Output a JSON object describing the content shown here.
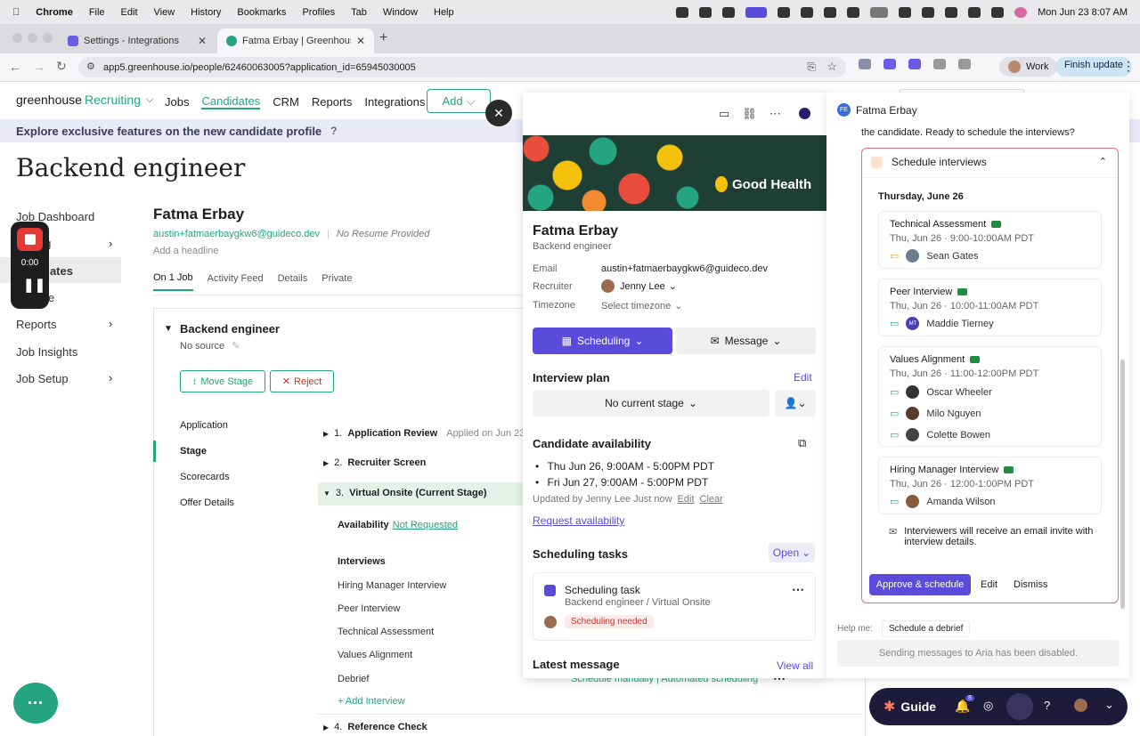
{
  "mac_menu": {
    "app": "Chrome",
    "items": [
      "File",
      "Edit",
      "View",
      "History",
      "Bookmarks",
      "Profiles",
      "Tab",
      "Window",
      "Help"
    ],
    "datetime": "Mon Jun 23  8:07 AM"
  },
  "tabs": [
    {
      "label": "Settings - Integrations"
    },
    {
      "label": "Fatma Erbay | Greenhouse Re"
    }
  ],
  "address": {
    "url": "app5.greenhouse.io/people/62460063005?application_id=65945030005",
    "profile": "Work",
    "finish": "Finish update"
  },
  "app_nav": {
    "brand": "greenhouse",
    "brand_sub": "Recruiting",
    "items": [
      "Jobs",
      "Candidates",
      "CRM",
      "Reports",
      "Integrations"
    ],
    "add": "Add"
  },
  "banner": {
    "text": "Explore exclusive features on the new candidate profile",
    "help": "?"
  },
  "page": {
    "title": "Backend engineer"
  },
  "sidebar": {
    "items": [
      "Job Dashboard",
      "ing",
      "dates",
      "e",
      "Reports",
      "Job Insights",
      "Job Setup"
    ]
  },
  "recorder": {
    "time": "0:00"
  },
  "candidate": {
    "name": "Fatma Erbay",
    "email": "austin+fatmaerbaygkw6@guideco.dev",
    "resume": "No Resume Provided",
    "headline": "Add a headline",
    "tabs": [
      "On 1 Job",
      "Activity Feed",
      "Details",
      "Private"
    ]
  },
  "job_card": {
    "title": "Backend engineer",
    "source": "No source",
    "move": "Move Stage",
    "reject": "Reject",
    "left_nav": [
      "Application",
      "Stage",
      "Scorecards",
      "Offer Details"
    ],
    "stages": [
      {
        "num": "1.",
        "label": "Application Review",
        "note": "Applied on Jun 23,"
      },
      {
        "num": "2.",
        "label": "Recruiter Screen",
        "note": ""
      },
      {
        "num": "3.",
        "label": "Virtual Onsite (Current Stage)",
        "note": ""
      }
    ],
    "availability_label": "Availability",
    "availability_value": "Not Requested",
    "interviews_label": "Interviews",
    "interviews": [
      "Hiring Manager Interview",
      "Peer Interview",
      "Technical Assessment",
      "Values Alignment",
      "Debrief"
    ],
    "add_interview": "+ Add Interview",
    "debrief_links": "Schedule manually | Automated scheduling",
    "stage4": {
      "num": "4.",
      "label": "Reference Check"
    }
  },
  "profile": {
    "banner_brand": "Good Health",
    "name": "Fatma Erbay",
    "role": "Backend engineer",
    "fields": [
      {
        "label": "Email",
        "value": "austin+fatmaerbaygkw6@guideco.dev"
      },
      {
        "label": "Recruiter",
        "value": "Jenny Lee"
      },
      {
        "label": "Timezone",
        "value": "Select timezone"
      }
    ],
    "scheduling_btn": "Scheduling",
    "message_btn": "Message",
    "interview_plan": "Interview plan",
    "edit": "Edit",
    "stage_select": "No current stage",
    "availability_title": "Candidate availability",
    "slots": [
      "Thu Jun 26, 9:00AM - 5:00PM PDT",
      "Fri Jun 27, 9:00AM - 5:00PM PDT"
    ],
    "updated": "Updated by Jenny Lee  Just now",
    "edit2": "Edit",
    "clear": "Clear",
    "request": "Request availability",
    "tasks_title": "Scheduling tasks",
    "open": "Open",
    "task_title": "Scheduling task",
    "task_sub": "Backend engineer / Virtual Onsite",
    "task_badge": "Scheduling needed",
    "latest": "Latest message",
    "view_all": "View all"
  },
  "aria": {
    "user_initials": "FE",
    "user": "Fatma Erbay",
    "prompt": "the candidate. Ready to schedule the interviews?",
    "card_title": "Schedule interviews",
    "date": "Thursday, June 26",
    "interviews": [
      {
        "title": "Technical Assessment",
        "time": "Thu, Jun 26 · 9:00-10:00AM PDT",
        "people": [
          "Sean Gates"
        ]
      },
      {
        "title": "Peer Interview",
        "time": "Thu, Jun 26 · 10:00-11:00AM PDT",
        "people": [
          "Maddie Tierney"
        ],
        "initials": "MT"
      },
      {
        "title": "Values Alignment",
        "time": "Thu, Jun 26 · 11:00-12:00PM PDT",
        "people": [
          "Oscar Wheeler",
          "Milo Nguyen",
          "Colette Bowen"
        ]
      },
      {
        "title": "Hiring Manager Interview",
        "time": "Thu, Jun 26 · 12:00-1:00PM PDT",
        "people": [
          "Amanda Wilson"
        ]
      }
    ],
    "notice": "Interviewers will receive an email invite with interview details.",
    "approve": "Approve & schedule",
    "edit": "Edit",
    "dismiss": "Dismiss",
    "help_label": "Help me:",
    "help_chip": "Schedule a debrief",
    "disabled": "Sending messages to Aria has been disabled."
  },
  "guide": {
    "label": "Guide",
    "badge": "8"
  },
  "colors": {
    "accent": "#5b4bdb",
    "green": "#24a47f",
    "brand_bg": "#1f3f35"
  }
}
